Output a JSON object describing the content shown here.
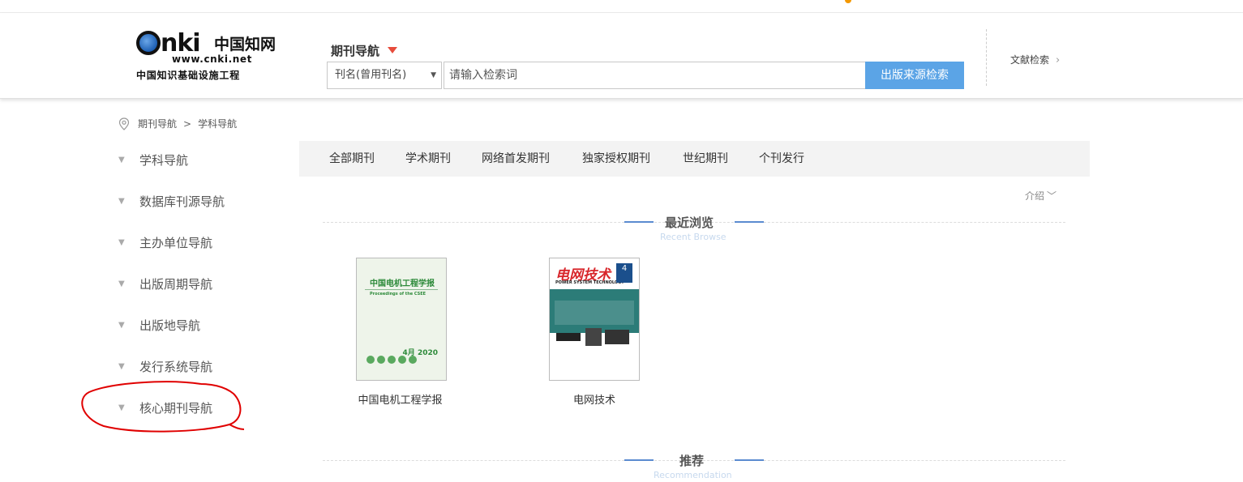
{
  "header": {
    "logo": {
      "brand_latin": "nki",
      "brand_cn": "中国知网",
      "url": "www.cnki.net",
      "subtitle": "中国知识基础设施工程"
    },
    "nav_title": "期刊导航",
    "search": {
      "field_select": "刊名(曾用刊名)",
      "placeholder": "请输入检索词",
      "button": "出版来源检索"
    },
    "doc_search": "文献检索"
  },
  "breadcrumb": [
    "期刊导航",
    ">",
    "学科导航"
  ],
  "sidebar": {
    "items": [
      {
        "label": "学科导航"
      },
      {
        "label": "数据库刊源导航"
      },
      {
        "label": "主办单位导航"
      },
      {
        "label": "出版周期导航"
      },
      {
        "label": "出版地导航"
      },
      {
        "label": "发行系统导航"
      },
      {
        "label": "核心期刊导航"
      }
    ]
  },
  "tabs": [
    "全部期刊",
    "学术期刊",
    "网络首发期刊",
    "独家授权期刊",
    "世纪期刊",
    "个刊发行"
  ],
  "intro": "介绍",
  "recent": {
    "title": "最近浏览",
    "subtitle": "Recent Browse",
    "journals": [
      {
        "name": "中国电机工程学报",
        "cover_title": "中国电机工程学报",
        "cover_subtitle": "Proceedings of the CSEE",
        "cover_issue": "4月 2020"
      },
      {
        "name": "电网技术",
        "cover_title": "电网技术",
        "cover_subtitle": "POWER SYSTEM TECHNOLOGY",
        "cover_issue": "4"
      }
    ]
  },
  "recommend": {
    "title": "推荐",
    "subtitle": "Recommendation"
  },
  "colors": {
    "accent": "#5ba4e6",
    "annotation": "#e00000",
    "tabbar": "#f3f3f3",
    "caret": "#e74c3c"
  }
}
